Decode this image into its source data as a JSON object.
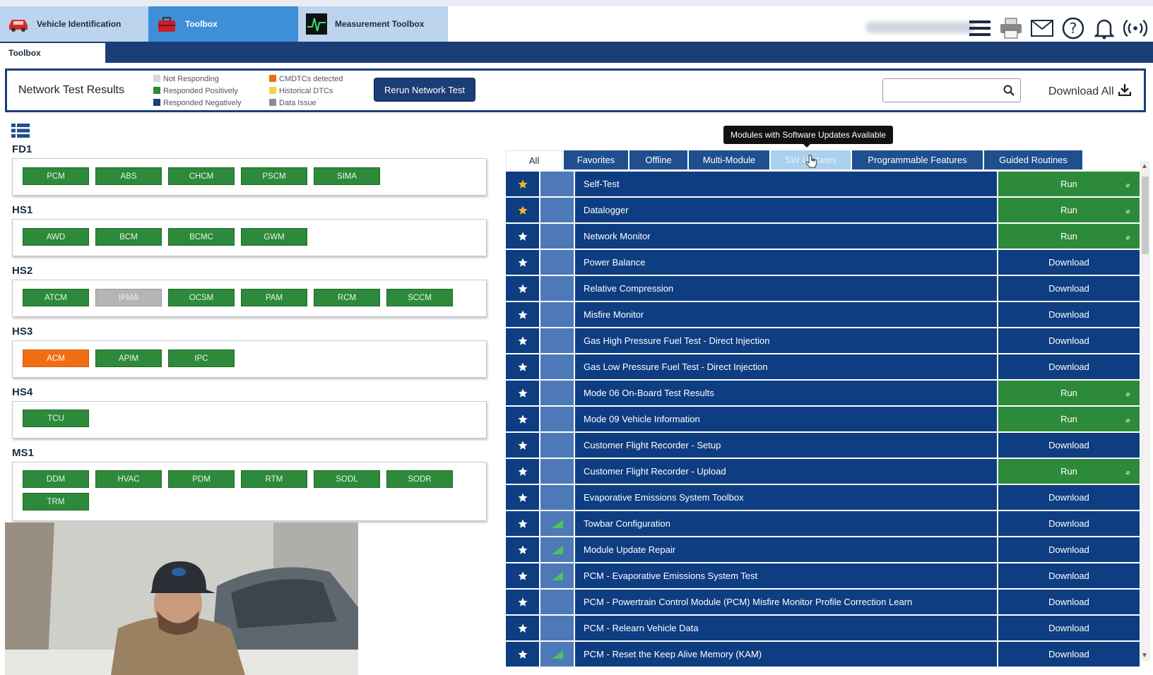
{
  "app_tabs": [
    {
      "label": "Vehicle Identification",
      "icon": "car-icon"
    },
    {
      "label": "Toolbox",
      "icon": "toolbox-icon"
    },
    {
      "label": "Measurement Toolbox",
      "icon": "oscilloscope-icon"
    }
  ],
  "top_icons": [
    "menu-icon",
    "printer-icon",
    "mail-icon",
    "help-icon",
    "bell-icon",
    "connection-icon"
  ],
  "subtab": "Toolbox",
  "network_results": {
    "title": "Network Test Results",
    "legend_left": [
      {
        "label": "Not Responding",
        "color": "#d9d9d9"
      },
      {
        "label": "Responded Positively",
        "color": "#2d8a3a"
      },
      {
        "label": "Responded Negatively",
        "color": "#1c3e77"
      }
    ],
    "legend_right": [
      {
        "label": "CMDTCs detected",
        "color": "#f26d12"
      },
      {
        "label": "Historical DTCs",
        "color": "#f5d24b"
      },
      {
        "label": "Data Issue",
        "color": "#8c8c8c"
      }
    ],
    "rerun_label": "Rerun Network Test",
    "search_placeholder": "",
    "download_all_label": "Download All"
  },
  "networks": [
    {
      "name": "FD1",
      "modules": [
        {
          "label": "PCM",
          "state": "positive"
        },
        {
          "label": "ABS",
          "state": "positive"
        },
        {
          "label": "CHCM",
          "state": "positive"
        },
        {
          "label": "PSCM",
          "state": "positive"
        },
        {
          "label": "SIMA",
          "state": "positive"
        }
      ]
    },
    {
      "name": "HS1",
      "modules": [
        {
          "label": "AWD",
          "state": "positive"
        },
        {
          "label": "BCM",
          "state": "positive"
        },
        {
          "label": "BCMC",
          "state": "positive"
        },
        {
          "label": "GWM",
          "state": "positive"
        }
      ]
    },
    {
      "name": "HS2",
      "modules": [
        {
          "label": "ATCM",
          "state": "positive"
        },
        {
          "label": "IPMA",
          "state": "not-responding"
        },
        {
          "label": "OCSM",
          "state": "positive"
        },
        {
          "label": "PAM",
          "state": "positive"
        },
        {
          "label": "RCM",
          "state": "positive"
        },
        {
          "label": "SCCM",
          "state": "positive"
        }
      ]
    },
    {
      "name": "HS3",
      "modules": [
        {
          "label": "ACM",
          "state": "cmdtc"
        },
        {
          "label": "APIM",
          "state": "positive"
        },
        {
          "label": "IPC",
          "state": "positive"
        }
      ]
    },
    {
      "name": "HS4",
      "modules": [
        {
          "label": "TCU",
          "state": "positive"
        }
      ]
    },
    {
      "name": "MS1",
      "modules": [
        {
          "label": "DDM",
          "state": "positive"
        },
        {
          "label": "HVAC",
          "state": "positive"
        },
        {
          "label": "PDM",
          "state": "positive"
        },
        {
          "label": "RTM",
          "state": "positive"
        },
        {
          "label": "SODL",
          "state": "positive"
        },
        {
          "label": "SODR",
          "state": "positive"
        },
        {
          "label": "TRM",
          "state": "positive"
        }
      ]
    }
  ],
  "tooltip": "Modules with Software Updates Available",
  "filter_tabs": [
    "All",
    "Favorites",
    "Offline",
    "Multi-Module",
    "SW Updates",
    "Programmable Features",
    "Guided Routines"
  ],
  "active_filter_tab": "All",
  "hovered_filter_tab": "SW Updates",
  "tools": [
    {
      "name": "Self-Test",
      "action": "Run",
      "favorite": true,
      "signal": false
    },
    {
      "name": "Datalogger",
      "action": "Run",
      "favorite": true,
      "signal": false
    },
    {
      "name": "Network Monitor",
      "action": "Run",
      "favorite": false,
      "signal": false
    },
    {
      "name": "Power Balance",
      "action": "Download",
      "favorite": false,
      "signal": false
    },
    {
      "name": "Relative Compression",
      "action": "Download",
      "favorite": false,
      "signal": false
    },
    {
      "name": "Misfire Monitor",
      "action": "Download",
      "favorite": false,
      "signal": false
    },
    {
      "name": "Gas High Pressure Fuel Test - Direct Injection",
      "action": "Download",
      "favorite": false,
      "signal": false
    },
    {
      "name": "Gas Low Pressure Fuel Test - Direct Injection",
      "action": "Download",
      "favorite": false,
      "signal": false
    },
    {
      "name": "Mode 06 On-Board Test Results",
      "action": "Run",
      "favorite": false,
      "signal": false
    },
    {
      "name": "Mode 09 Vehicle Information",
      "action": "Run",
      "favorite": false,
      "signal": false
    },
    {
      "name": "Customer Flight Recorder - Setup",
      "action": "Download",
      "favorite": false,
      "signal": false
    },
    {
      "name": "Customer Flight Recorder - Upload",
      "action": "Run",
      "favorite": false,
      "signal": false
    },
    {
      "name": "Evaporative Emissions System Toolbox",
      "action": "Download",
      "favorite": false,
      "signal": false
    },
    {
      "name": "Towbar Configuration",
      "action": "Download",
      "favorite": false,
      "signal": true
    },
    {
      "name": "Module Update Repair",
      "action": "Download",
      "favorite": false,
      "signal": true
    },
    {
      "name": "PCM - Evaporative Emissions System Test",
      "action": "Download",
      "favorite": false,
      "signal": true
    },
    {
      "name": "PCM - Powertrain Control Module (PCM) Misfire Monitor Profile Correction Learn",
      "action": "Download",
      "favorite": false,
      "signal": false
    },
    {
      "name": "PCM - Relearn Vehicle Data",
      "action": "Download",
      "favorite": false,
      "signal": false
    },
    {
      "name": "PCM - Reset the Keep Alive Memory (KAM)",
      "action": "Download",
      "favorite": false,
      "signal": true
    }
  ],
  "colors": {
    "brand_blue": "#1c3e77",
    "row_blue": "#0f3d82",
    "run_green": "#2d8a3a",
    "alert_orange": "#f26d12",
    "star_gold": "#f0b429"
  }
}
